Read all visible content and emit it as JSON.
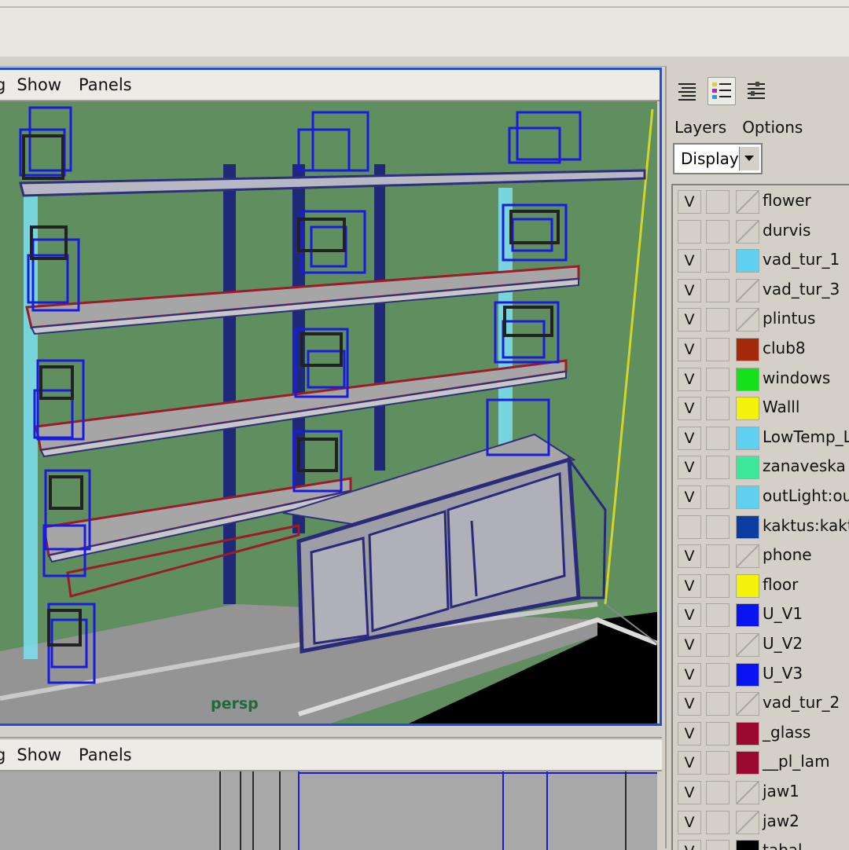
{
  "top_panel": {
    "menu": [
      "g",
      "Show",
      "Panels"
    ],
    "camera_label": "persp"
  },
  "bottom_panel": {
    "menu": [
      "g",
      "Show",
      "Panels"
    ]
  },
  "layer_editor": {
    "icons": [
      "layers-list-icon",
      "layers-color-icon",
      "layers-options-icon"
    ],
    "tabs": [
      "Layers",
      "Options"
    ],
    "display_select": "Display",
    "layers": [
      {
        "visible": "V",
        "name": "flower",
        "color": null
      },
      {
        "visible": "",
        "name": "durvis",
        "color": null
      },
      {
        "visible": "V",
        "name": "vad_tur_1",
        "color": "#5fd0f0"
      },
      {
        "visible": "V",
        "name": "vad_tur_3",
        "color": null
      },
      {
        "visible": "V",
        "name": "plintus",
        "color": null
      },
      {
        "visible": "V",
        "name": "club8",
        "color": "#a32a0a"
      },
      {
        "visible": "V",
        "name": "windows",
        "color": "#14e01c"
      },
      {
        "visible": "V",
        "name": "Walll",
        "color": "#f2f20a"
      },
      {
        "visible": "V",
        "name": "LowTemp_L",
        "color": "#5fd0f0"
      },
      {
        "visible": "V",
        "name": "zanaveska",
        "color": "#3ce89a"
      },
      {
        "visible": "V",
        "name": "outLight:out_",
        "color": "#5fd0f0"
      },
      {
        "visible": "",
        "name": "kaktus:kaktu",
        "color": "#0a3ea0"
      },
      {
        "visible": "V",
        "name": "phone",
        "color": null
      },
      {
        "visible": "V",
        "name": "floor",
        "color": "#f2f20a"
      },
      {
        "visible": "V",
        "name": "U_V1",
        "color": "#0a14f0"
      },
      {
        "visible": "V",
        "name": "U_V2",
        "color": null
      },
      {
        "visible": "V",
        "name": "U_V3",
        "color": "#0a14f0"
      },
      {
        "visible": "V",
        "name": "vad_tur_2",
        "color": null
      },
      {
        "visible": "V",
        "name": "_glass",
        "color": "#9a0a2e"
      },
      {
        "visible": "V",
        "name": "__pl_lam",
        "color": "#9a0a2e"
      },
      {
        "visible": "V",
        "name": "jaw1",
        "color": null
      },
      {
        "visible": "V",
        "name": "jaw2",
        "color": null
      },
      {
        "visible": "V",
        "name": "tabal",
        "color": "#000000"
      }
    ]
  }
}
